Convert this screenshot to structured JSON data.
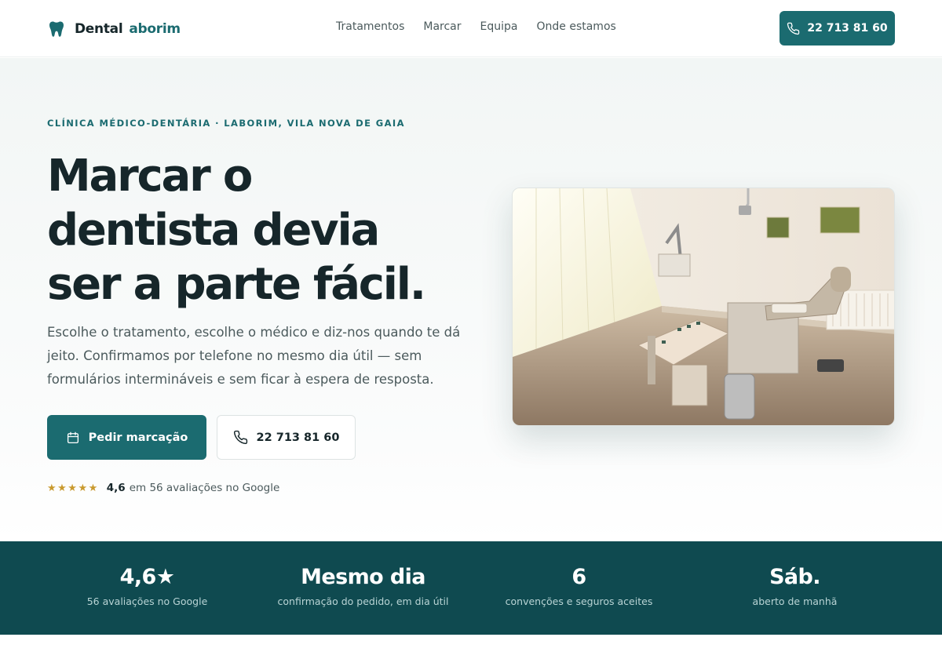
{
  "header": {
    "brand_part1": "Dental",
    "brand_part2": "aborim",
    "nav": [
      "Tratamentos",
      "Marcar",
      "Equipa",
      "Onde estamos"
    ],
    "phone": "22 713 81 60"
  },
  "hero": {
    "eyebrow": "CLÍNICA MÉDICO-DENTÁRIA · LABORIM, VILA NOVA DE GAIA",
    "headline_lines": [
      "Marcar o",
      "dentista devia",
      "ser a parte fácil."
    ],
    "lead_lines": [
      "Escolhe o tratamento, escolhe o médico e diz-nos quando te dá",
      "jeito. Confirmamos por telefone no mesmo dia útil — sem",
      "formulários intermináveis e sem ficar à espera de resposta."
    ],
    "primary_button": "Pedir marcação",
    "secondary_button": "22 713 81 60",
    "rating": {
      "stars": "★★★★★",
      "score": "4,6",
      "text": "em 56 avaliações no Google",
      "value": 4.6
    }
  },
  "stats": [
    {
      "value": "4,6★",
      "label": "56 avaliações no Google"
    },
    {
      "value": "Mesmo dia",
      "label": "confirmação do pedido, em dia útil"
    },
    {
      "value": "6",
      "label": "convenções e seguros aceites"
    },
    {
      "value": "Sáb.",
      "label": "aberto de manhã"
    }
  ],
  "colors": {
    "accent": "#1b6b70",
    "stats_band": "#0f4a50",
    "star": "#c99a2e",
    "heading": "#16262a"
  },
  "icons": {
    "logo": "tooth-icon",
    "phone": "phone-icon",
    "calendar": "calendar-icon"
  }
}
